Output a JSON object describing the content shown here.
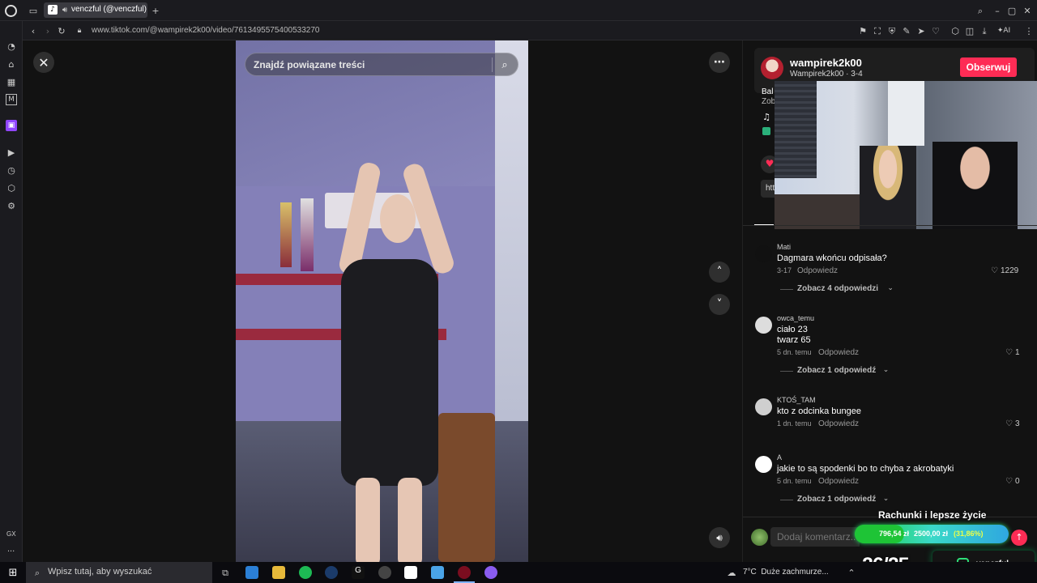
{
  "browser": {
    "tab_title": "venczful (@venczful) |",
    "url": "www.tiktok.com/@wampirek2k00/video/7613495575400533270",
    "sidebar_label_gx": "GX",
    "sidebar_more": "..."
  },
  "video_overlay": {
    "search_placeholder": "Znajdź powiązane treści"
  },
  "author": {
    "username": "wampirek2k00",
    "subline": "Wampirek2k00 · 3-4",
    "follow_label": "Obserwuj",
    "desc_partial_1": "Bal",
    "desc_partial_2": "Zob",
    "link_partial": "htt"
  },
  "comments": [
    {
      "user": "Mati",
      "text": [
        "Dagmara wkońcu odpisała?"
      ],
      "date": "3-17",
      "reply": "Odpowiedz",
      "likes": "1229",
      "view_replies": "Zobacz 4 odpowiedzi"
    },
    {
      "user": "owca_temu",
      "text": [
        "ciało 23",
        "twarz 65"
      ],
      "date": "5 dn. temu",
      "reply": "Odpowiedz",
      "likes": "1",
      "view_replies": "Zobacz 1 odpowiedź"
    },
    {
      "user": "KTOŚ_TAM",
      "text": [
        "kto z odcinka bungee"
      ],
      "date": "1 dn. temu",
      "reply": "Odpowiedz",
      "likes": "3"
    },
    {
      "user": "A",
      "text": [
        "jakie to są spodenki bo to chyba z akrobatyki"
      ],
      "date": "5 dn. temu",
      "reply": "Odpowiedz",
      "likes": "0",
      "view_replies": "Zobacz 1 odpowiedź"
    }
  ],
  "comment_input": {
    "placeholder": "Dodaj komentarz..."
  },
  "stream_overlay": {
    "goal_title": "Rachunki i lepsze życie",
    "goal_current": "796,54 zł",
    "goal_target": "2500,00 zł",
    "goal_percent_label": "(31,86%)",
    "goal_progress": 0.3186,
    "counter": "26/25",
    "instagram_handle": "venczful"
  },
  "taskbar": {
    "search_placeholder": "Wpisz tutaj, aby wyszukać",
    "weather": "7°C  Duże zachmurze..."
  }
}
